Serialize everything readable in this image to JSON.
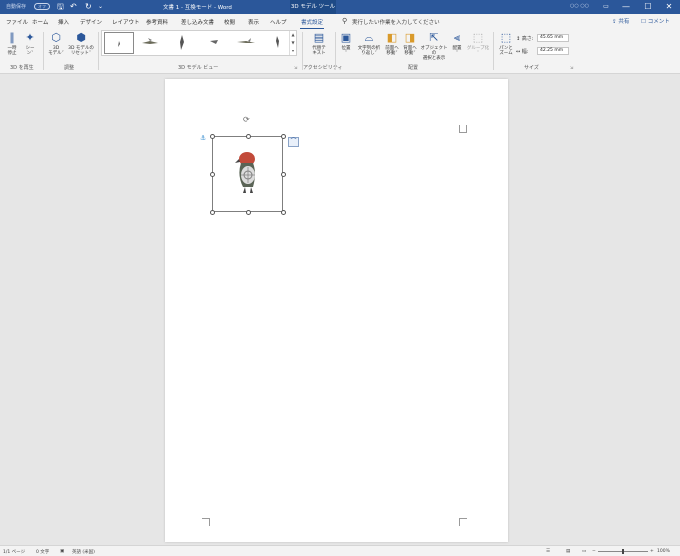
{
  "titlebar": {
    "autosave_label": "自動保存",
    "autosave_state": "オフ",
    "qat": {
      "save": "🖫",
      "undo": "↶",
      "redo": "↻",
      "customize": "⌄"
    },
    "title": "文書 1 - 互換モード - Word",
    "contextual_tab": "3D モデル ツール",
    "user": "○○ ○○",
    "controls": {
      "ribbon_options": "▭",
      "minimize": "—",
      "maximize": "☐",
      "close": "✕"
    }
  },
  "tabs": [
    "ファイル",
    "ホーム",
    "挿入",
    "デザイン",
    "レイアウト",
    "参考資料",
    "差し込み文書",
    "校閲",
    "表示",
    "ヘルプ",
    "書式設定"
  ],
  "active_tab": "書式設定",
  "search": {
    "placeholder": "実行したい作業を入力してください"
  },
  "share_label": "共有",
  "comment_label": "コメント",
  "ribbon": {
    "play": {
      "pause": "一時\n停止",
      "scenes": "シー\nン˅",
      "group": "3D を再生"
    },
    "adjust": {
      "model": "3D\nモデル˅",
      "reset": "3D モデルの\nリセット˅",
      "group": "調整"
    },
    "views": {
      "group": "3D モデル ビュー"
    },
    "accessibility": {
      "alt_text": "代替テ\nキスト",
      "group": "アクセシビリティ"
    },
    "arrange": {
      "position": "位置\n˅",
      "wrap": "文字列の折\nり返し˅",
      "forward": "前面へ\n移動˅",
      "backward": "背面へ\n移動˅",
      "selection": "オブジェクトの\n選択と表示",
      "align": "配置\n˅",
      "group_btn": "グループ化\n˅",
      "group": "配置"
    },
    "size": {
      "pan_zoom": "パンと\nズーム",
      "height_label": "高さ:",
      "height_value": "45.65 mm",
      "width_label": "幅:",
      "width_value": "42.25 mm",
      "group": "サイズ"
    }
  },
  "status": {
    "page": "1/1 ページ",
    "words": "0 文字",
    "language": "英語 (米国)",
    "zoom": "100%",
    "zoom_minus": "−",
    "zoom_plus": "+"
  },
  "colors": {
    "accent": "#2b579a",
    "ribbon_bg": "#f3f3f3",
    "canvas_bg": "#e6e6e6"
  }
}
